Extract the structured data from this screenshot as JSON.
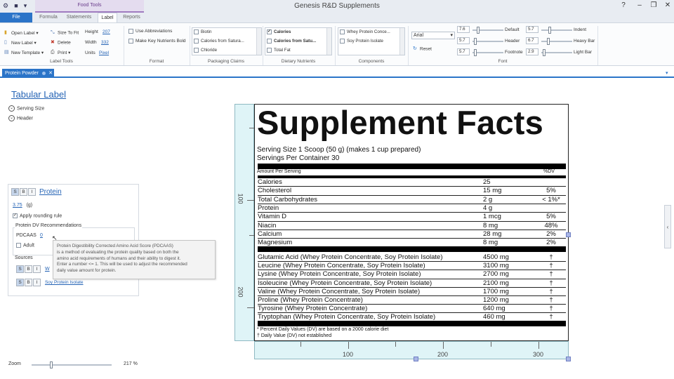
{
  "window": {
    "title": "Genesis R&D Supplements",
    "context_tab": "Food Tools"
  },
  "ribbon_tabs": [
    "File",
    "Formula",
    "Statements",
    "Label",
    "Reports"
  ],
  "label_tools": {
    "open_label": "Open Label",
    "new_label": "New Label",
    "new_template": "New Template",
    "size_to_fit": "Size To Fit",
    "delete": "Delete",
    "print": "Print",
    "height_label": "Height",
    "height_value": "207",
    "width_label": "Width",
    "width_value": "332",
    "units_label": "Units",
    "units_value": "Pixel",
    "group": "Label Tools"
  },
  "format": {
    "use_abbreviations": "Use Abbreviations",
    "bold_key_nutrients": "Make Key Nutrients Bold",
    "group": "Format"
  },
  "packaging_claims": {
    "items": [
      "Biotin",
      "Calories from Satura...",
      "Chloride"
    ],
    "group": "Packaging Claims"
  },
  "dietary_nutrients": {
    "items": [
      "Calories",
      "Calories from Satu...",
      "Total Fat"
    ],
    "group": "Dietary Nutrients"
  },
  "components": {
    "items": [
      "Whey Protein Conce...",
      "Soy Protein Isolate"
    ],
    "group": "Components"
  },
  "font": {
    "family": "Arial",
    "reset": "Reset",
    "sizes": [
      {
        "value": "7.6",
        "label": "Default",
        "value2": "5.7",
        "label2": "Indent"
      },
      {
        "value": "5.7",
        "label": "Header",
        "value2": "6.7",
        "label2": "Heavy Bar"
      },
      {
        "value": "5.7",
        "label": "Footnote",
        "value2": "2.9",
        "label2": "Light Bar"
      }
    ],
    "group": "Font"
  },
  "doc_tab": "Protein Powder",
  "left_panel": {
    "title": "Tabular Label",
    "serving_size": "Serving Size",
    "header": "Header",
    "style_s": "S",
    "style_b": "B",
    "style_i": "I",
    "nutrient": "Protein",
    "amount": "3.75",
    "unit": "(g)",
    "apply_rounding": "Apply rounding rule",
    "dv_title": "Protein DV Recommendations",
    "pdcaas_label": "PDCAAS",
    "pdcaas_value": "0",
    "adult": "Adult",
    "sources": "Sources",
    "source_partial": "W",
    "source_2": "Soy Protein Isolate"
  },
  "tooltip": {
    "title": "Protein Digestibility Corrected Amino Acid Score (PDCAAS)",
    "lines": [
      "is a method of evaluating the protein quality based on both the",
      "amino acid requirements of humans and their ability to digest it.",
      "Enter a number <= 1. This will be used to adjust the recommended",
      "daily value amount for protein."
    ]
  },
  "rulers": {
    "v": [
      "100",
      "200"
    ],
    "h": [
      "100",
      "200",
      "300"
    ]
  },
  "label": {
    "title": "Supplement Facts",
    "serving_size": "Serving Size 1 Scoop (50 g) (makes 1 cup prepared)",
    "servings_per_container": "Servings Per Container 30",
    "amount_per_serving": "Amount Per Serving",
    "dv_header": "%DV",
    "nutrients": [
      {
        "name": "Calories",
        "amount": "25",
        "dv": ""
      },
      {
        "name": "Cholesterol",
        "amount": "15 mg",
        "dv": "5%"
      },
      {
        "name": "Total Carbohydrates",
        "amount": "2 g",
        "dv": "< 1%*"
      },
      {
        "name": "Protein",
        "amount": "4 g",
        "dv": ""
      },
      {
        "name": "Vitamin D",
        "amount": "1 mcg",
        "dv": "5%"
      },
      {
        "name": "Niacin",
        "amount": "8 mg",
        "dv": "48%"
      },
      {
        "name": "Calcium",
        "amount": "28 mg",
        "dv": "2%"
      },
      {
        "name": "Magnesium",
        "amount": "8 mg",
        "dv": "2%"
      }
    ],
    "amino_acids": [
      {
        "name": "Glutamic Acid (Whey Protein Concentrate, Soy Protein Isolate)",
        "amount": "4500 mg",
        "dv": "†"
      },
      {
        "name": "Leucine (Whey Protein Concentrate, Soy Protein Isolate)",
        "amount": "3100 mg",
        "dv": "†"
      },
      {
        "name": "Lysine (Whey Protein Concentrate, Soy Protein Isolate)",
        "amount": "2700 mg",
        "dv": "†"
      },
      {
        "name": "Isoleucine (Whey Protein Concentrate, Soy Protein Isolate)",
        "amount": "2100 mg",
        "dv": "†"
      },
      {
        "name": "Valine (Whey Protein Concentrate, Soy Protein Isolate)",
        "amount": "1700 mg",
        "dv": "†"
      },
      {
        "name": "Proline (Whey Protein Concentrate)",
        "amount": "1200 mg",
        "dv": "†"
      },
      {
        "name": "Tyrosine (Whey Protein Concentrate)",
        "amount": "640 mg",
        "dv": "†"
      },
      {
        "name": "Tryptophan (Whey Protein Concentrate, Soy Protein Isolate)",
        "amount": "460 mg",
        "dv": "†"
      }
    ],
    "footnote_1": "* Percent Daily Values (DV) are based on a 2000 calorie diet",
    "footnote_2": "† Daily Value (DV) not established"
  },
  "zoom": {
    "label": "Zoom",
    "value": "217 %",
    "level_percent": 217
  }
}
